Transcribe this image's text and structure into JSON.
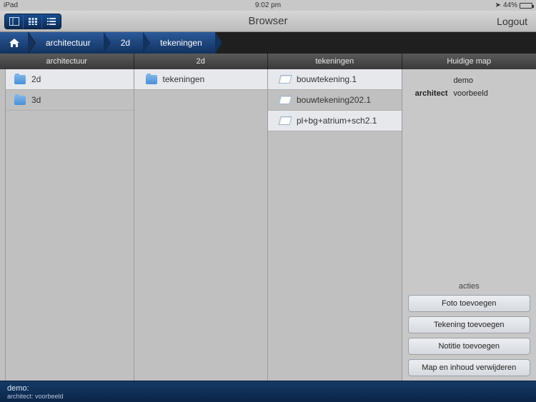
{
  "status": {
    "device": "iPad",
    "time": "9:02 pm",
    "battery_pct": "44%",
    "location_icon": "➤"
  },
  "header": {
    "title": "Browser",
    "logout": "Logout"
  },
  "breadcrumb": {
    "items": [
      "architectuur",
      "2d",
      "tekeningen"
    ]
  },
  "columns": {
    "headers": [
      "architectuur",
      "2d",
      "tekeningen",
      "Huidige map"
    ],
    "col0": [
      {
        "label": "2d"
      },
      {
        "label": "3d"
      }
    ],
    "col1": [
      {
        "label": "tekeningen"
      }
    ],
    "col2": [
      {
        "label": "bouwtekening.1"
      },
      {
        "label": "bouwtekening202.1"
      },
      {
        "label": "pl+bg+atrium+sch2.1"
      }
    ]
  },
  "details": {
    "name_value": "demo",
    "architect_label": "architect",
    "architect_value": "voorbeeld",
    "acties_label": "acties",
    "actions": [
      "Foto toevoegen",
      "Tekening toevoegen",
      "Notitie toevoegen",
      "Map en inhoud verwijderen"
    ]
  },
  "footer": {
    "line1": "demo:",
    "line2": "architect: voorbeeld"
  }
}
